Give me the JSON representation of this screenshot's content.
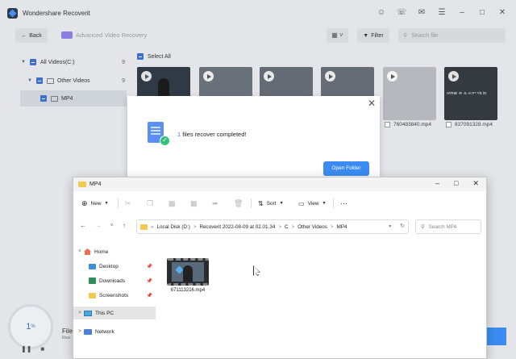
{
  "app": {
    "title": "Wondershare Recoverit",
    "back_label": "Back",
    "mode_label": "Advanced Video Recovery",
    "filter_label": "Filter",
    "search_placeholder": "Search file",
    "select_all_label": "Select All",
    "tree": [
      {
        "label": "All Videos(C:)",
        "count": "9"
      },
      {
        "label": "Other Videos",
        "count": "9"
      },
      {
        "label": "MP4",
        "count": ""
      }
    ],
    "thumbnails": [
      {
        "label": ""
      },
      {
        "label": ""
      },
      {
        "label": ""
      },
      {
        "label": ""
      },
      {
        "label": "760483840.mp4"
      },
      {
        "label": "837091328.mp4"
      }
    ],
    "thumb_overlay_text": "ATRIB -R -S -H F*.*/S /D",
    "progress_value": "1",
    "progress_unit": "%",
    "file_status_title": "File",
    "file_status_sub": "Rea"
  },
  "dialog": {
    "count": "1",
    "message": "files recover completed!",
    "open_folder_label": "Open Folder"
  },
  "explorer": {
    "title": "MP4",
    "cmd": {
      "new_label": "New",
      "sort_label": "Sort",
      "view_label": "View",
      "more_label": "···"
    },
    "breadcrumb": [
      "Local Disk (D:)",
      "Recoverit 2022-08-09 at 02.01.34",
      "C",
      "Other Videos",
      "MP4"
    ],
    "search_placeholder": "Search MP4",
    "nav": {
      "home": "Home",
      "desktop": "Desktop",
      "downloads": "Downloads",
      "screenshots": "Screenshots",
      "this_pc": "This PC",
      "network": "Network"
    },
    "files": [
      {
        "name": "671113216.mp4"
      }
    ]
  },
  "colors": {
    "accent": "#3b8cf2",
    "check": "#3c6fd2",
    "success": "#34c27a"
  }
}
